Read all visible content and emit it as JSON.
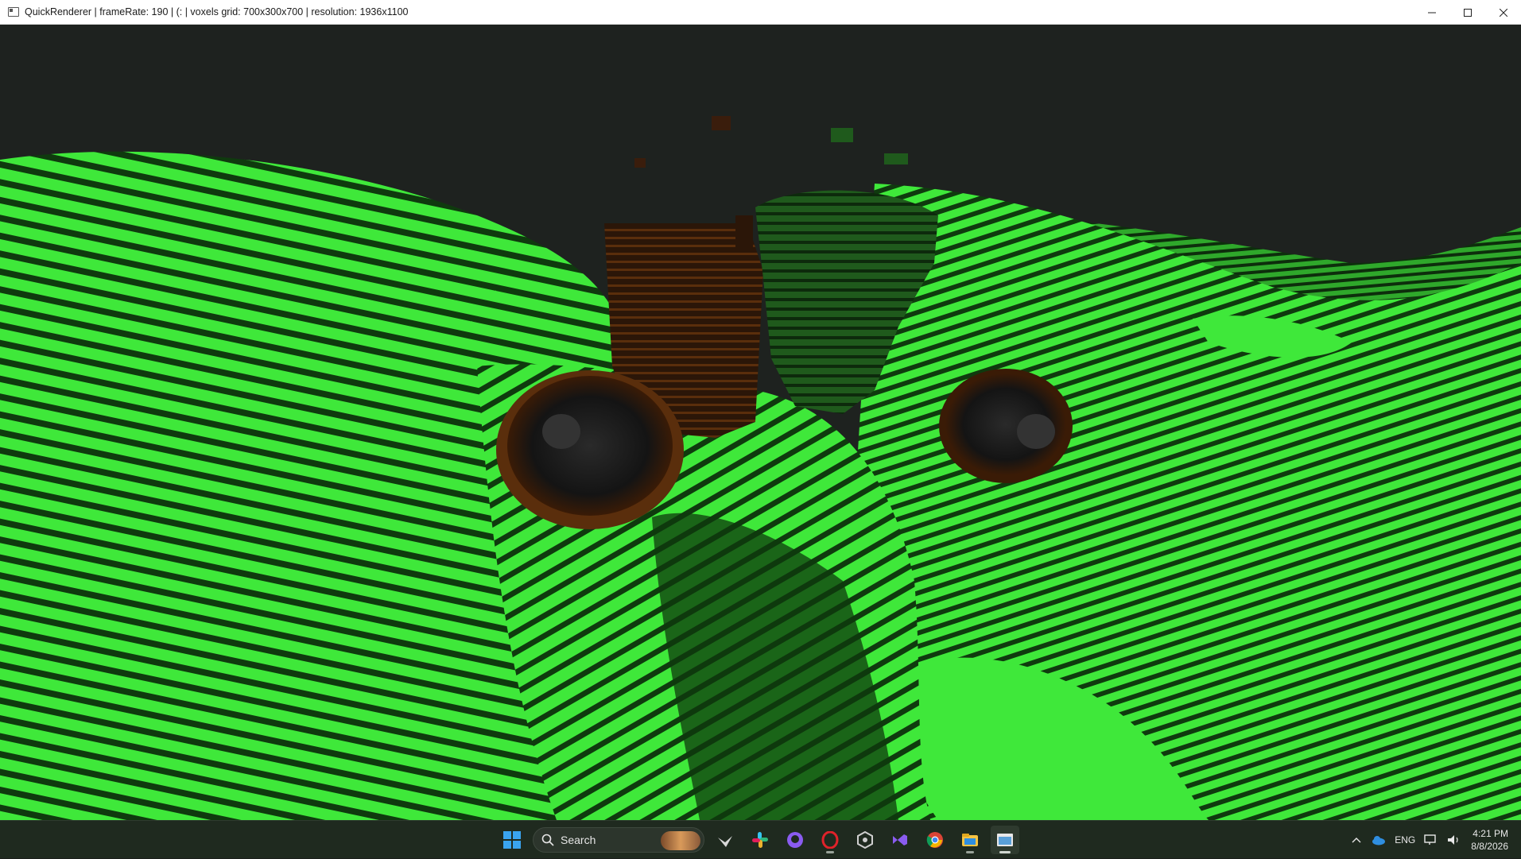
{
  "window": {
    "title": "QuickRenderer | frameRate: 190 | (: | voxels grid: 700x300x700 | resolution: 1936x1100",
    "controls": [
      "minimize-icon",
      "maximize-icon",
      "close-icon"
    ]
  },
  "scene": {
    "sky_color": "#1e221f",
    "terrain_color": "#3fe83a",
    "shadow_color": "#0f3a0e",
    "wood_color": "#3a1d0c"
  },
  "taskbar": {
    "search_label": "Search",
    "apps": [
      "windows-start-icon",
      "search-icon",
      "copilot-icon",
      "slack-icon",
      "github-icon",
      "opera-icon",
      "unity-icon",
      "visual-studio-icon",
      "chrome-icon",
      "file-explorer-icon",
      "quickrenderer-icon"
    ],
    "tray": {
      "lang": "ENG",
      "time": "4:21 PM",
      "date": "8/8/2026"
    }
  }
}
